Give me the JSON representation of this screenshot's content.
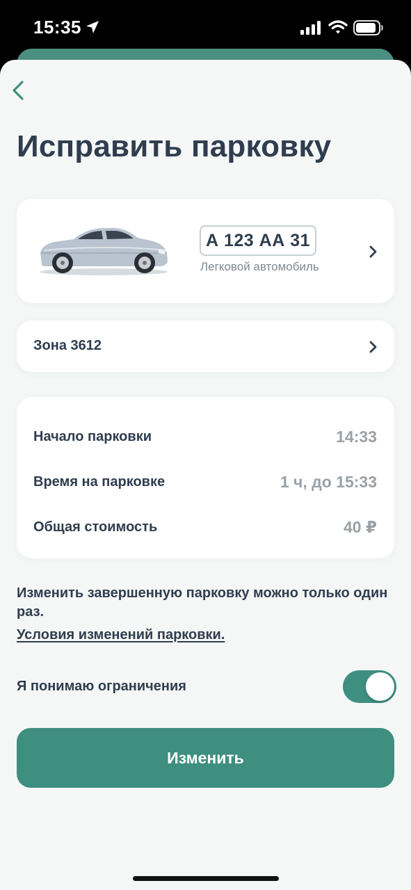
{
  "status_bar": {
    "time": "15:35",
    "icons": [
      "location-arrow-icon",
      "cellular-signal-icon",
      "wifi-icon",
      "battery-icon"
    ]
  },
  "header": {
    "back_icon": "chevron-left-icon",
    "title": "Исправить парковку"
  },
  "vehicle": {
    "plate": "А 123 АА 31",
    "type": "Легковой автомобиль",
    "image": "car-icon"
  },
  "zone": {
    "label": "Зона 3612"
  },
  "parking_info": {
    "rows": [
      {
        "label": "Начало парковки",
        "value": "14:33"
      },
      {
        "label": "Время на парковке",
        "value": "1 ч, до 15:33"
      },
      {
        "label": "Общая стоимость",
        "value": "40 ₽"
      }
    ]
  },
  "notice": "Изменить завершенную парковку можно только один раз.",
  "terms_link": "Условия изменений парковки.",
  "acknowledge": {
    "label": "Я понимаю ограничения",
    "checked": true
  },
  "submit_label": "Изменить",
  "colors": {
    "accent": "#3f8f80",
    "text_primary": "#2f3d4e",
    "text_muted": "#9aa1a6",
    "background": "#f5f7f7"
  }
}
